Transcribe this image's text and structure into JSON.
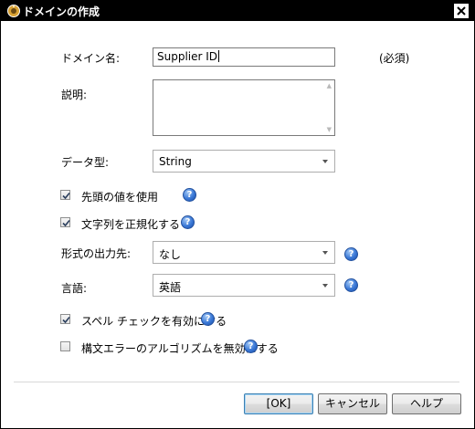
{
  "window": {
    "title": "ドメインの作成"
  },
  "form": {
    "domain_name_label": "ドメイン名:",
    "domain_name_value": "Supplier ID",
    "required_note": "(必須)",
    "description_label": "説明:",
    "description_value": "",
    "datatype_label": "データ型:",
    "datatype_value": "String",
    "use_first_value_label": "先頭の値を使用",
    "use_first_value_checked": true,
    "normalize_label": "文字列を正規化する",
    "normalize_checked": true,
    "output_format_label": "形式の出力先:",
    "output_format_value": "なし",
    "language_label": "言語:",
    "language_value": "英語",
    "spellcheck_label": "スペル チェックを有効にする",
    "spellcheck_checked": true,
    "disable_syntax_label": "構文エラーのアルゴリズムを無効にする",
    "disable_syntax_checked": false
  },
  "buttons": {
    "ok": "[OK]",
    "cancel": "キャンセル",
    "help": "ヘルプ"
  },
  "icons": {
    "help": "?"
  },
  "colors": {
    "title_bg": "#000000",
    "help_icon": "#3a78d6",
    "default_button_border": "#3c7fb1"
  }
}
